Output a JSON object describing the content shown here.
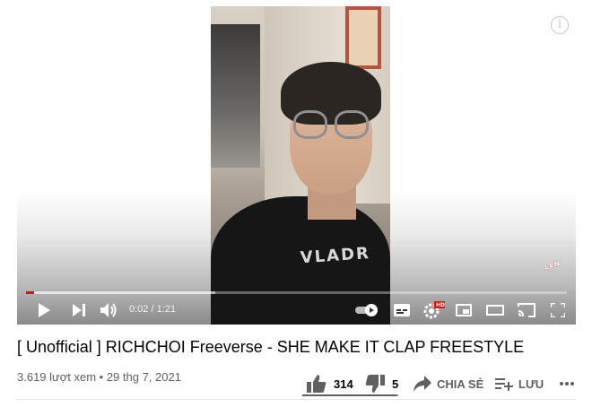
{
  "player": {
    "info_icon": "info-icon",
    "channel_watermark": "LEN",
    "shirt_print": "VLADR",
    "progress_played_fraction": 0.0157,
    "progress_buffered_fraction": 0.35,
    "accent_color": "#ff0000",
    "controls": {
      "play_icon": "play-icon",
      "next_icon": "next-icon",
      "volume_icon": "volume-icon",
      "current_time": "0:02",
      "separator": " / ",
      "duration": "1:21",
      "autoplay_icon": "autoplay-toggle-icon",
      "subtitles_icon": "subtitles-icon",
      "settings_icon": "settings-icon",
      "settings_badge": "HD",
      "miniplayer_icon": "miniplayer-icon",
      "theater_icon": "theater-icon",
      "cast_icon": "cast-icon",
      "fullscreen_icon": "fullscreen-icon"
    }
  },
  "video": {
    "title": "[ Unofficial ] RICHCHOI Freeverse - SHE MAKE IT CLAP FREESTYLE",
    "views": "3.619 lượt xem",
    "bullet": " • ",
    "date": "29 thg 7, 2021"
  },
  "actions": {
    "like_count": "314",
    "dislike_count": "5",
    "share_label": "CHIA SẺ",
    "save_label": "LƯU",
    "like_fraction": 0.984,
    "like_icon": "thumbs-up-icon",
    "dislike_icon": "thumbs-down-icon",
    "share_icon": "share-icon",
    "save_icon": "playlist-add-icon",
    "more_icon": "more-icon"
  }
}
